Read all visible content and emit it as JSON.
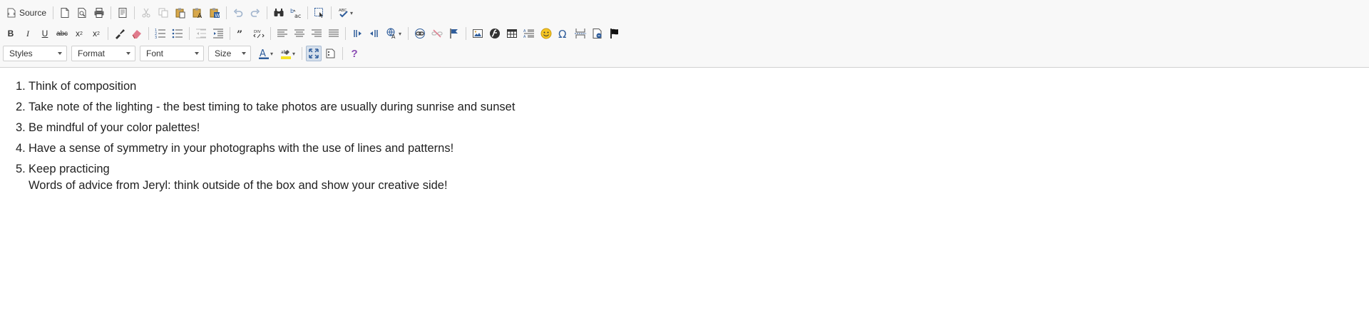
{
  "toolbar": {
    "source_label": "Source",
    "combos": {
      "styles": "Styles",
      "format": "Format",
      "font": "Font",
      "size": "Size"
    },
    "icons": {
      "new_page": "new-page-icon",
      "preview": "preview-icon",
      "print": "print-icon",
      "templates": "templates-icon",
      "cut": "cut-icon",
      "copy": "copy-icon",
      "paste": "paste-icon",
      "paste_text": "paste-text-icon",
      "paste_word": "paste-word-icon",
      "undo": "undo-icon",
      "redo": "redo-icon",
      "find": "find-icon",
      "replace": "replace-icon",
      "select_all": "select-all-icon",
      "spellcheck": "spellcheck-icon"
    },
    "bold": "B",
    "italic": "I",
    "underline": "U",
    "strike": "abc",
    "subscript": "x",
    "superscript": "x",
    "help": "?"
  },
  "colors": {
    "toolbar_bg": "#f8f8f8",
    "border": "#d1d1d1",
    "accent_blue": "#2f5d9b",
    "emoji_yellow": "#f6c623",
    "help_purple": "#8a4bb3"
  },
  "content": {
    "items": [
      {
        "num": "1.",
        "text": "Think of composition"
      },
      {
        "num": "2.",
        "text": "Take note of the lighting - the best timing to take photos are usually during sunrise and sunset"
      },
      {
        "num": "3.",
        "text": "Be mindful of your color palettes!"
      },
      {
        "num": "4.",
        "text": "Have a sense of symmetry in your photographs with the use of lines and patterns!"
      },
      {
        "num": "5.",
        "text": "Keep practicing",
        "sub": "Words of advice from Jeryl: think outside of the box and show your creative side!"
      }
    ]
  }
}
